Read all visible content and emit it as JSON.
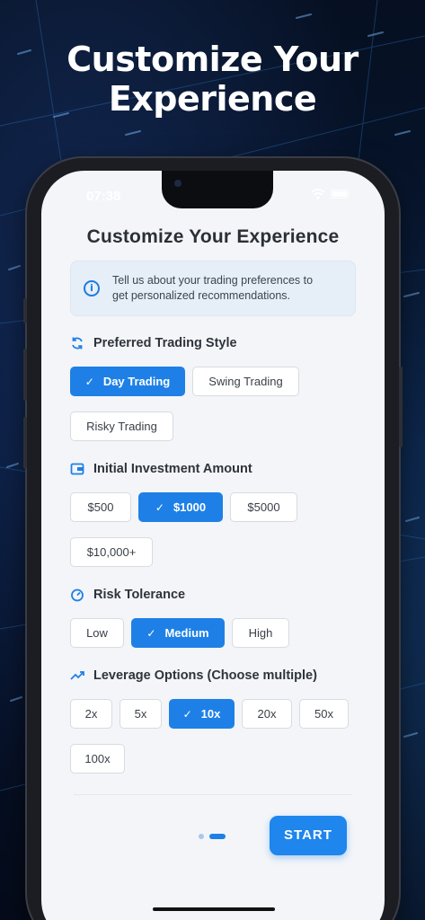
{
  "promo": {
    "title_line1": "Customize Your",
    "title_line2": "Experience"
  },
  "status_bar": {
    "time": "07:38"
  },
  "screen": {
    "title": "Customize Your Experience",
    "info_line1": "Tell us about your trading preferences to",
    "info_line2": "get personalized recommendations.",
    "info_icon": "info-icon"
  },
  "sections": {
    "trading_style": {
      "title": "Preferred Trading Style",
      "icon": "refresh-icon",
      "options": [
        "Day Trading",
        "Swing Trading",
        "Risky Trading"
      ],
      "selected": "Day Trading"
    },
    "investment": {
      "title": "Initial Investment Amount",
      "icon": "wallet-icon",
      "options": [
        "$500",
        "$1000",
        "$5000",
        "$10,000+"
      ],
      "selected": "$1000"
    },
    "risk": {
      "title": "Risk Tolerance",
      "icon": "gauge-icon",
      "options": [
        "Low",
        "Medium",
        "High"
      ],
      "selected": "Medium"
    },
    "leverage": {
      "title": "Leverage Options (Choose multiple)",
      "icon": "trending-up-icon",
      "options": [
        "2x",
        "5x",
        "10x",
        "20x",
        "50x",
        "100x"
      ],
      "selected": [
        "10x"
      ]
    }
  },
  "pagination": {
    "current": 2,
    "total": 2
  },
  "actions": {
    "start_label": "START"
  },
  "colors": {
    "accent": "#1e80e6",
    "background": "#f3f5f9",
    "info_bg": "#e6eef8"
  }
}
